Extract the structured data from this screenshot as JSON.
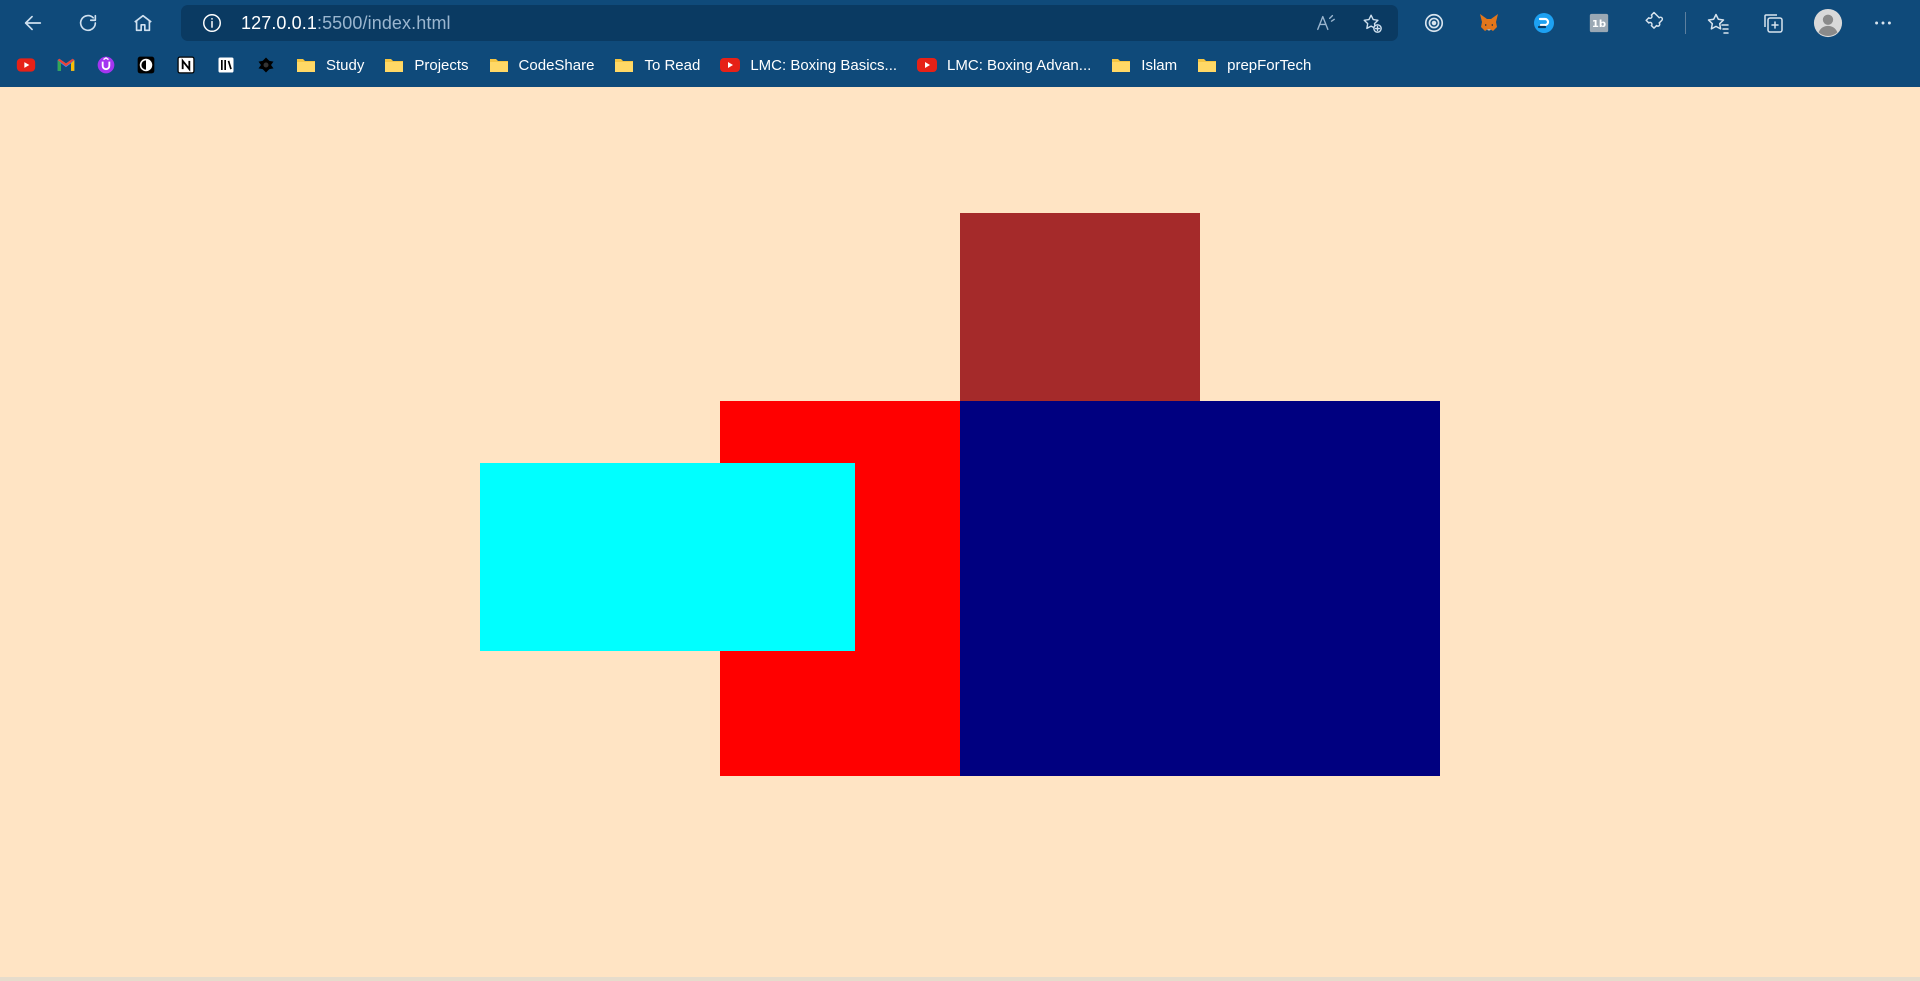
{
  "browser": {
    "url_host": "127.0.0.1",
    "url_rest": ":5500/index.html",
    "nav_icons": [
      "back-arrow-icon",
      "refresh-icon",
      "home-icon"
    ],
    "address_icons": [
      "site-info-icon",
      "read-aloud-icon",
      "add-favorite-icon"
    ],
    "extensions": [
      "target-extension-icon",
      "metamask-fox-icon",
      "blue-circle-extension-icon",
      "1b-extension-icon",
      "extensions-puzzle-icon",
      "favorites-star-icon",
      "collections-icon",
      "profile-avatar-icon",
      "more-menu-icon"
    ]
  },
  "bookmarks": {
    "icon_only": [
      "youtube-icon",
      "gmail-icon",
      "purple-u-icon",
      "circle-logo-icon",
      "notion-icon",
      "book-icon",
      "dark-blob-icon"
    ],
    "items": [
      {
        "label": "Study",
        "type": "folder"
      },
      {
        "label": "Projects",
        "type": "folder"
      },
      {
        "label": "CodeShare",
        "type": "folder"
      },
      {
        "label": "To Read",
        "type": "folder"
      },
      {
        "label": "LMC: Boxing Basics...",
        "type": "youtube"
      },
      {
        "label": "LMC: Boxing Advan...",
        "type": "youtube"
      },
      {
        "label": "Islam",
        "type": "folder"
      },
      {
        "label": "prepForTech",
        "type": "folder"
      }
    ]
  },
  "page": {
    "background": "#ffe4c4",
    "boxes": {
      "brown": "#a52a2a",
      "red": "#ff0000",
      "navy": "#000080",
      "cyan": "#00ffff"
    }
  },
  "colors": {
    "chrome": "#0f4a7a",
    "address_bar": "#0a3a62",
    "folder": "#f5c542",
    "youtube": "#e62117"
  }
}
